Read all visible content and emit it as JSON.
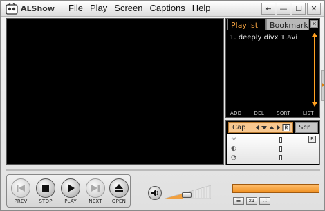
{
  "app": {
    "title": "ALShow"
  },
  "menu": [
    {
      "label": "File",
      "mnemonic": "F"
    },
    {
      "label": "Play",
      "mnemonic": "P"
    },
    {
      "label": "Screen",
      "mnemonic": "S"
    },
    {
      "label": "Captions",
      "mnemonic": "C"
    },
    {
      "label": "Help",
      "mnemonic": "H"
    }
  ],
  "window_controls": {
    "pin": "⇤",
    "minimize": "—",
    "maximize": "☐",
    "close": "✕"
  },
  "playlist": {
    "tabs": {
      "playlist": "Playlist",
      "bookmark": "Bookmark"
    },
    "close": "✕",
    "entries": [
      "1. deeply divx 1.avi"
    ],
    "buttons": {
      "add": "ADD",
      "del": "DEL",
      "sort": "SORT",
      "list": "LIST"
    }
  },
  "captions": {
    "tab": "Cap",
    "screen_tab": "Scr",
    "reset": "R",
    "sliders": [
      {
        "icon": "brightness-icon",
        "level": 0.55
      },
      {
        "icon": "contrast-icon",
        "level": 0.55
      },
      {
        "icon": "saturation-icon",
        "level": 0.55
      }
    ]
  },
  "controls": {
    "prev": "PREV",
    "stop": "STOP",
    "play": "PLAY",
    "next": "NEXT",
    "open": "OPEN"
  },
  "volume": {
    "level": 0.4
  },
  "progress": {
    "level": 1.0
  },
  "mini_buttons": {
    "list": "☰",
    "x1": "x1",
    "full": "⛶"
  },
  "colors": {
    "accent": "#f09020",
    "tab_active": "#f0a040"
  }
}
